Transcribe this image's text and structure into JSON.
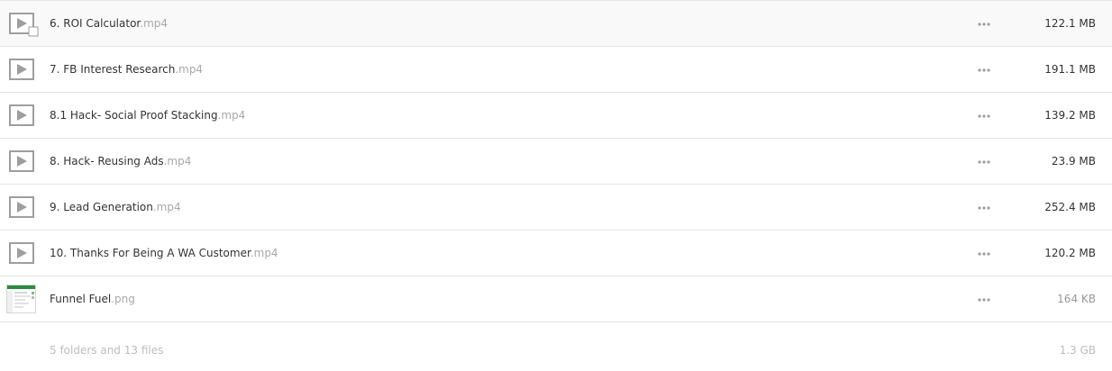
{
  "files": [
    {
      "base": "6. ROI Calculator",
      "ext": ".mp4",
      "size": "122.1 MB",
      "icon": "video-icon",
      "hovered": true
    },
    {
      "base": "7. FB Interest Research",
      "ext": ".mp4",
      "size": "191.1 MB",
      "icon": "video-icon"
    },
    {
      "base": "8.1 Hack- Social Proof Stacking",
      "ext": ".mp4",
      "size": "139.2 MB",
      "icon": "video-icon"
    },
    {
      "base": "8. Hack- Reusing Ads",
      "ext": ".mp4",
      "size": "23.9 MB",
      "icon": "video-icon"
    },
    {
      "base": "9. Lead Generation",
      "ext": ".mp4",
      "size": "252.4 MB",
      "icon": "video-icon"
    },
    {
      "base": "10. Thanks For Being A WA Customer",
      "ext": ".mp4",
      "size": "120.2 MB",
      "icon": "video-icon"
    },
    {
      "base": "Funnel Fuel",
      "ext": ".png",
      "size": "164 KB",
      "icon": "image-thumbnail-icon"
    }
  ],
  "footer": {
    "summary": "5 folders and 13 files",
    "total": "1.3 GB"
  },
  "icons": {
    "more": "more-options-icon"
  },
  "colors": {
    "text": "#333333",
    "extension": "#a8a8a8",
    "muted": "#bdbdbd",
    "divider": "#e5e5e5",
    "hover_row": "#f9f9f9",
    "icon_gray": "#999999"
  }
}
